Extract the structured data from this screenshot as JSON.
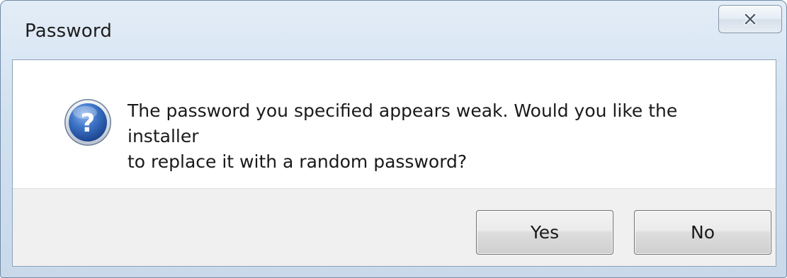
{
  "window": {
    "title": "Password"
  },
  "dialog": {
    "message_line1": "The password you specified appears weak. Would you like the installer",
    "message_line2": "to replace it with a random password?",
    "icon": "question-icon"
  },
  "buttons": {
    "yes_label": "Yes",
    "no_label": "No",
    "close_icon": "close-icon"
  },
  "colors": {
    "icon_blue": "#2a5fb0",
    "icon_ring": "#d8dee6",
    "footer_bg": "#f0f0f0"
  }
}
